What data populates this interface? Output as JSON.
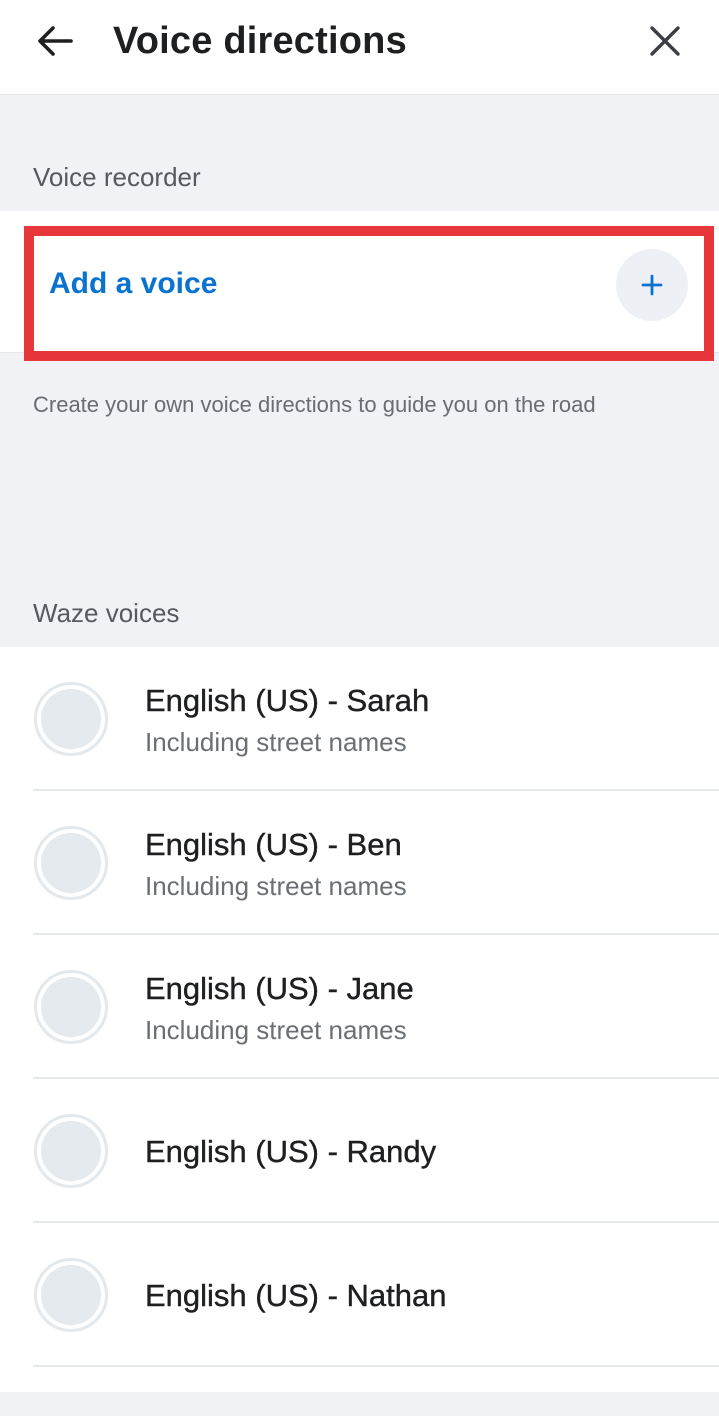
{
  "header": {
    "title": "Voice directions",
    "back_icon": "arrow-left-icon",
    "close_icon": "close-icon"
  },
  "recorder": {
    "section_label": "Voice recorder",
    "add_label": "Add a voice",
    "add_icon": "plus-icon",
    "helper_text": "Create your own voice directions to guide you on the road"
  },
  "waze_voices": {
    "section_label": "Waze voices",
    "items": [
      {
        "name": "English (US) - Sarah",
        "subtitle": "Including street names"
      },
      {
        "name": "English (US) - Ben",
        "subtitle": "Including street names"
      },
      {
        "name": "English (US) - Jane",
        "subtitle": "Including street names"
      },
      {
        "name": "English (US) - Randy",
        "subtitle": ""
      },
      {
        "name": "English (US) - Nathan",
        "subtitle": ""
      }
    ]
  },
  "colors": {
    "accent": "#0a73cf",
    "highlight": "#e8373b",
    "background": "#f0f2f6"
  }
}
